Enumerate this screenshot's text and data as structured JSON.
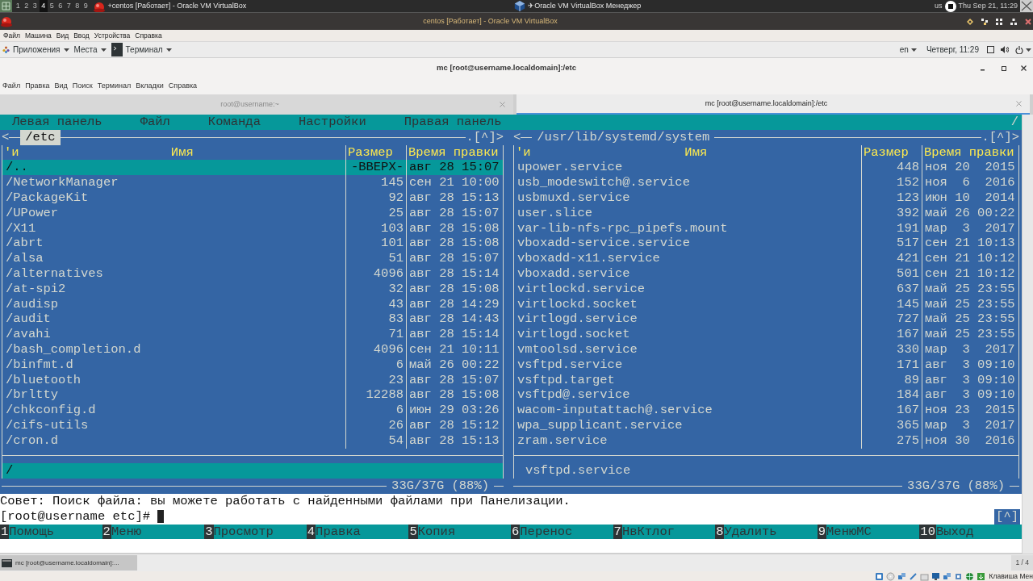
{
  "top_bar": {
    "workspaces": [
      {
        "label": "1",
        "selected": false
      },
      {
        "label": "2",
        "selected": false
      },
      {
        "label": "3",
        "selected": false
      },
      {
        "label": "4",
        "selected": true
      },
      {
        "label": "5",
        "selected": false
      },
      {
        "label": "6",
        "selected": false
      },
      {
        "label": "7",
        "selected": false
      },
      {
        "label": "8",
        "selected": false
      },
      {
        "label": "9",
        "selected": false
      }
    ],
    "tasks": [
      {
        "kind": "vm",
        "title": "+centos [Работает] - Oracle VM VirtualBox"
      },
      {
        "kind": "manager",
        "title": "✈Oracle VM VirtualBox Менеджер"
      }
    ],
    "keyboard": "us",
    "clock": "Thu Sep 21, 11:29"
  },
  "vbox_window": {
    "title": "centos [Работает] - Oracle VM VirtualBox",
    "menu": [
      "Файл",
      "Машина",
      "Вид",
      "Ввод",
      "Устройства",
      "Справка"
    ]
  },
  "gnome_panel": {
    "menus": [
      {
        "kind": "apps",
        "label": "Приложения"
      },
      {
        "kind": "places",
        "label": "Места"
      },
      {
        "kind": "app",
        "label": "Терминал"
      }
    ],
    "language": "en",
    "clock": "Четверг, 11:29"
  },
  "terminal_window": {
    "title": "mc [root@username.localdomain]:/etc",
    "menu": [
      "Файл",
      "Правка",
      "Вид",
      "Поиск",
      "Терминал",
      "Вкладки",
      "Справка"
    ],
    "tabs": [
      {
        "label": "root@username:~",
        "selected": false
      },
      {
        "label": "mc [root@username.localdomain]:/etc",
        "selected": true
      }
    ]
  },
  "mc": {
    "menu": [
      "Левая панель",
      "Файл",
      "Команда",
      "Настройки",
      "Правая панель"
    ],
    "menu_marker": "/",
    "panels": [
      {
        "active": true,
        "back": "<",
        "path": "/etc",
        "corner": ".[^]>",
        "columns": {
          "mark": "'и",
          "name": "Имя",
          "size": "Размер",
          "date": "Время правки"
        },
        "rows": [
          {
            "name": "/..",
            "size": "-ВВЕРХ-",
            "date": "авг 28 15:07",
            "selected": true
          },
          {
            "name": "/NetworkManager",
            "size": "145",
            "date": "сен 21 10:00",
            "selected": false
          },
          {
            "name": "/PackageKit",
            "size": "92",
            "date": "авг 28 15:13",
            "selected": false
          },
          {
            "name": "/UPower",
            "size": "25",
            "date": "авг 28 15:07",
            "selected": false
          },
          {
            "name": "/X11",
            "size": "103",
            "date": "авг 28 15:08",
            "selected": false
          },
          {
            "name": "/abrt",
            "size": "101",
            "date": "авг 28 15:08",
            "selected": false
          },
          {
            "name": "/alsa",
            "size": "51",
            "date": "авг 28 15:07",
            "selected": false
          },
          {
            "name": "/alternatives",
            "size": "4096",
            "date": "авг 28 15:14",
            "selected": false
          },
          {
            "name": "/at-spi2",
            "size": "32",
            "date": "авг 28 15:08",
            "selected": false
          },
          {
            "name": "/audisp",
            "size": "43",
            "date": "авг 28 14:29",
            "selected": false
          },
          {
            "name": "/audit",
            "size": "83",
            "date": "авг 28 14:43",
            "selected": false
          },
          {
            "name": "/avahi",
            "size": "71",
            "date": "авг 28 15:14",
            "selected": false
          },
          {
            "name": "/bash_completion.d",
            "size": "4096",
            "date": "сен 21 10:11",
            "selected": false
          },
          {
            "name": "/binfmt.d",
            "size": "6",
            "date": "май 26 00:22",
            "selected": false
          },
          {
            "name": "/bluetooth",
            "size": "23",
            "date": "авг 28 15:07",
            "selected": false
          },
          {
            "name": "/brltty",
            "size": "12288",
            "date": "авг 28 15:08",
            "selected": false
          },
          {
            "name": "/chkconfig.d",
            "size": "6",
            "date": "июн 29 03:26",
            "selected": false
          },
          {
            "name": "/cifs-utils",
            "size": "26",
            "date": "авг 28 15:12",
            "selected": false
          },
          {
            "name": "/cron.d",
            "size": "54",
            "date": "авг 28 15:13",
            "selected": false
          }
        ],
        "status": "/",
        "disk": "33G/37G (88%)"
      },
      {
        "active": false,
        "back": "<",
        "path": "/usr/lib/systemd/system",
        "corner": ".[^]>",
        "columns": {
          "mark": "'и",
          "name": "Имя",
          "size": "Размер",
          "date": "Время правки"
        },
        "rows": [
          {
            "name": "upower.service",
            "size": "448",
            "date": "ноя 20  2015",
            "selected": false
          },
          {
            "name": "usb_modeswitch@.service",
            "size": "152",
            "date": "ноя  6  2016",
            "selected": false
          },
          {
            "name": "usbmuxd.service",
            "size": "123",
            "date": "июн 10  2014",
            "selected": false
          },
          {
            "name": "user.slice",
            "size": "392",
            "date": "май 26 00:22",
            "selected": false
          },
          {
            "name": "var-lib-nfs-rpc_pipefs.mount",
            "size": "191",
            "date": "мар  3  2017",
            "selected": false
          },
          {
            "name": "vboxadd-service.service",
            "size": "517",
            "date": "сен 21 10:13",
            "selected": false
          },
          {
            "name": "vboxadd-x11.service",
            "size": "421",
            "date": "сен 21 10:12",
            "selected": false
          },
          {
            "name": "vboxadd.service",
            "size": "501",
            "date": "сен 21 10:12",
            "selected": false
          },
          {
            "name": "virtlockd.service",
            "size": "637",
            "date": "май 25 23:55",
            "selected": false
          },
          {
            "name": "virtlockd.socket",
            "size": "145",
            "date": "май 25 23:55",
            "selected": false
          },
          {
            "name": "virtlogd.service",
            "size": "727",
            "date": "май 25 23:55",
            "selected": false
          },
          {
            "name": "virtlogd.socket",
            "size": "167",
            "date": "май 25 23:55",
            "selected": false
          },
          {
            "name": "vmtoolsd.service",
            "size": "330",
            "date": "мар  3  2017",
            "selected": false
          },
          {
            "name": "vsftpd.service",
            "size": "171",
            "date": "авг  3 09:10",
            "selected": false
          },
          {
            "name": "vsftpd.target",
            "size": "89",
            "date": "авг  3 09:10",
            "selected": false
          },
          {
            "name": "vsftpd@.service",
            "size": "184",
            "date": "авг  3 09:10",
            "selected": false
          },
          {
            "name": "wacom-inputattach@.service",
            "size": "167",
            "date": "ноя 23  2015",
            "selected": false
          },
          {
            "name": "wpa_supplicant.service",
            "size": "365",
            "date": "мар  3  2017",
            "selected": false
          },
          {
            "name": "zram.service",
            "size": "275",
            "date": "ноя 30  2016",
            "selected": false
          }
        ],
        "status": "vsftpd.service",
        "disk": "33G/37G (88%)"
      }
    ],
    "hint": "Совет: Поиск файла: вы можете работать с найденными файлами при Панелизации.",
    "prompt": "[root@username etc]#",
    "scroll_marker": "[^]",
    "keys": [
      {
        "number": "1",
        "label": "Помощь"
      },
      {
        "number": "2",
        "label": "Меню"
      },
      {
        "number": "3",
        "label": "Просмотр"
      },
      {
        "number": "4",
        "label": "Правка"
      },
      {
        "number": "5",
        "label": "Копия"
      },
      {
        "number": "6",
        "label": "Перенос"
      },
      {
        "number": "7",
        "label": "НвКтлог"
      },
      {
        "number": "8",
        "label": "Удалить"
      },
      {
        "number": "9",
        "label": "МенюМС"
      },
      {
        "number": "10",
        "label": "Выход"
      }
    ]
  },
  "taskbar": {
    "items": [
      {
        "label": "mc [root@username.localdomain]:...",
        "selected": true
      }
    ],
    "pager": "1 / 4"
  },
  "vbox_status": {
    "host_key": "Клавиша Мен"
  }
}
